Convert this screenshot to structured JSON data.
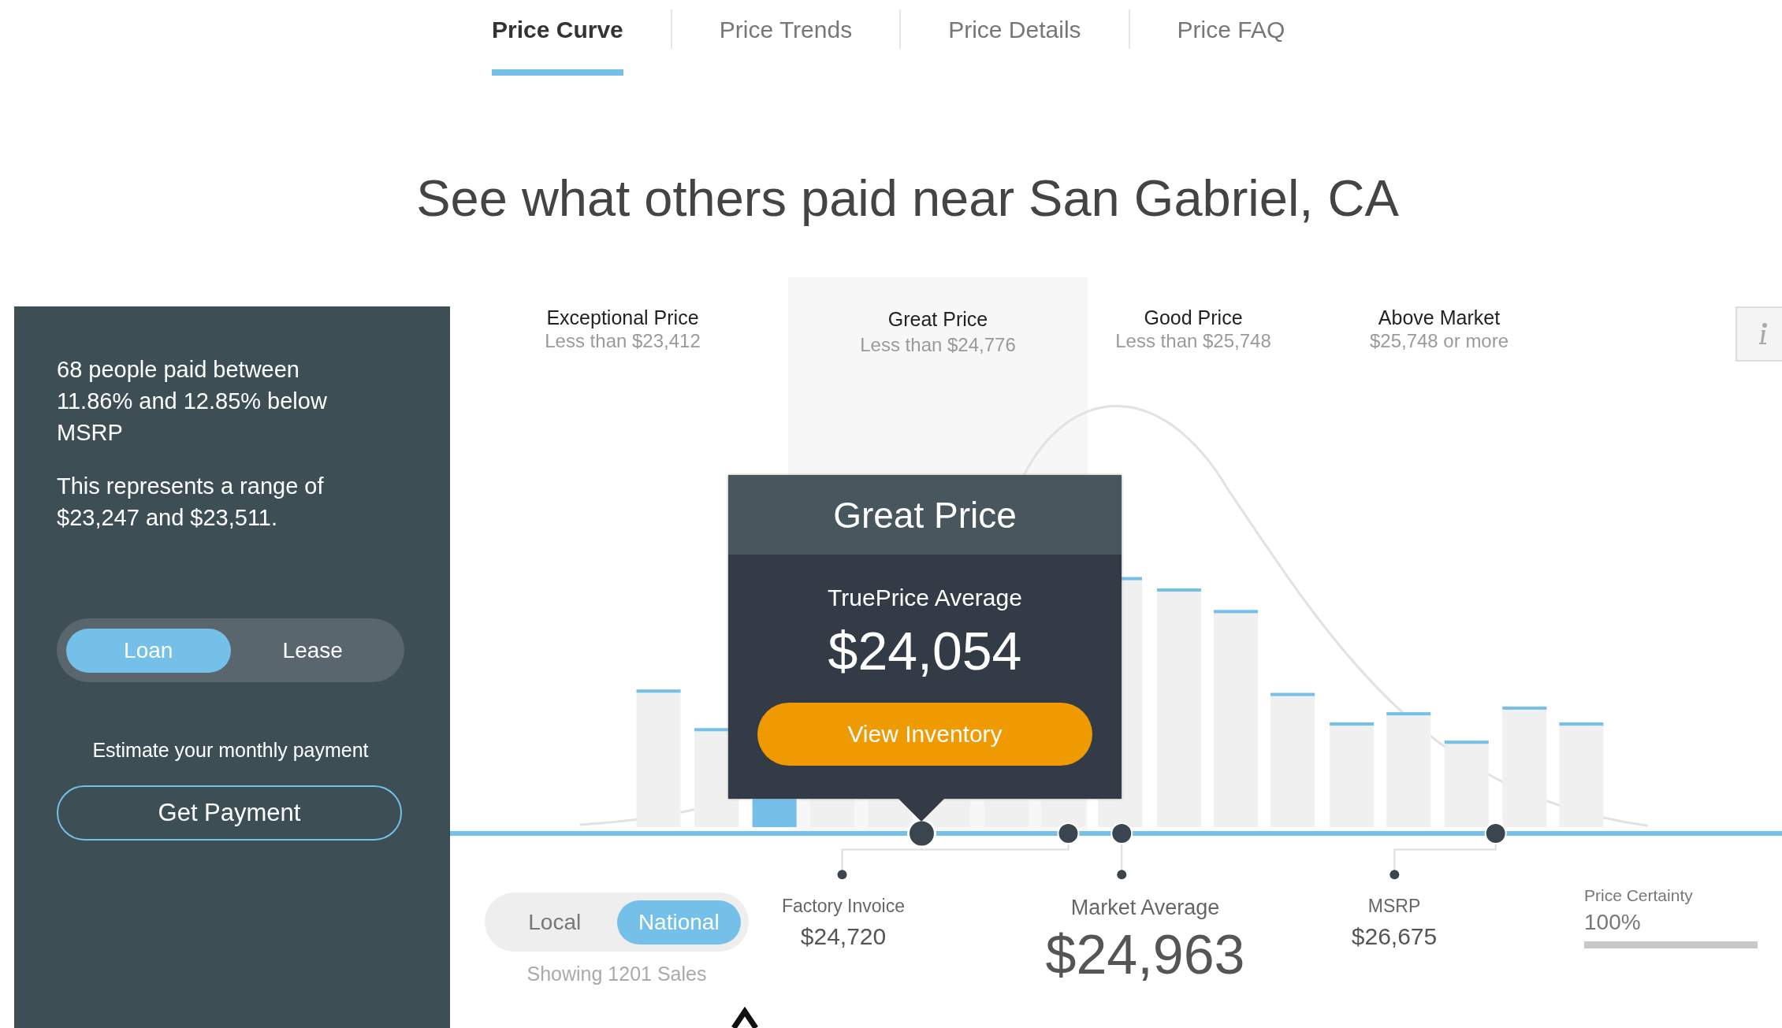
{
  "tabs": [
    {
      "label": "Price Curve",
      "selected": true
    },
    {
      "label": "Price Trends",
      "selected": false
    },
    {
      "label": "Price Details",
      "selected": false
    },
    {
      "label": "Price FAQ",
      "selected": false
    }
  ],
  "headline": "See what others paid near San Gabriel, CA",
  "summary": [
    "68 people paid between 11.86% and 12.85% below MSRP",
    "This represents a range of $23,247 and $23,511."
  ],
  "payment_type": [
    {
      "label": "Loan",
      "selected": true
    },
    {
      "label": "Lease",
      "selected": false
    }
  ],
  "estimate_label": "Estimate your monthly payment",
  "payment_button": "Get Payment",
  "price_bands": [
    {
      "title": "Exceptional Price",
      "range": "Less than $23,412",
      "selected": false
    },
    {
      "title": "Great Price",
      "range": "Less than $24,776",
      "selected": true
    },
    {
      "title": "Good Price",
      "range": "Less than $25,748",
      "selected": false
    },
    {
      "title": "Above Market",
      "range": "$25,748 or more",
      "selected": false
    }
  ],
  "tooltip": {
    "title": "Great Price",
    "subtitle": "TruePrice Average",
    "price": "$24,054",
    "button": "View Inventory"
  },
  "scope": [
    {
      "label": "Local",
      "selected": false
    },
    {
      "label": "National",
      "selected": true
    }
  ],
  "sales_count": "Showing 1201 Sales",
  "factory_invoice": {
    "label": "Factory Invoice",
    "value": "$24,720"
  },
  "market_average": {
    "label": "Market Average",
    "value": "$24,963"
  },
  "msrp": {
    "label": "MSRP",
    "value": "$26,675"
  },
  "price_certainty": {
    "label": "Price Certainty",
    "value": "100%",
    "level": 1
  }
}
